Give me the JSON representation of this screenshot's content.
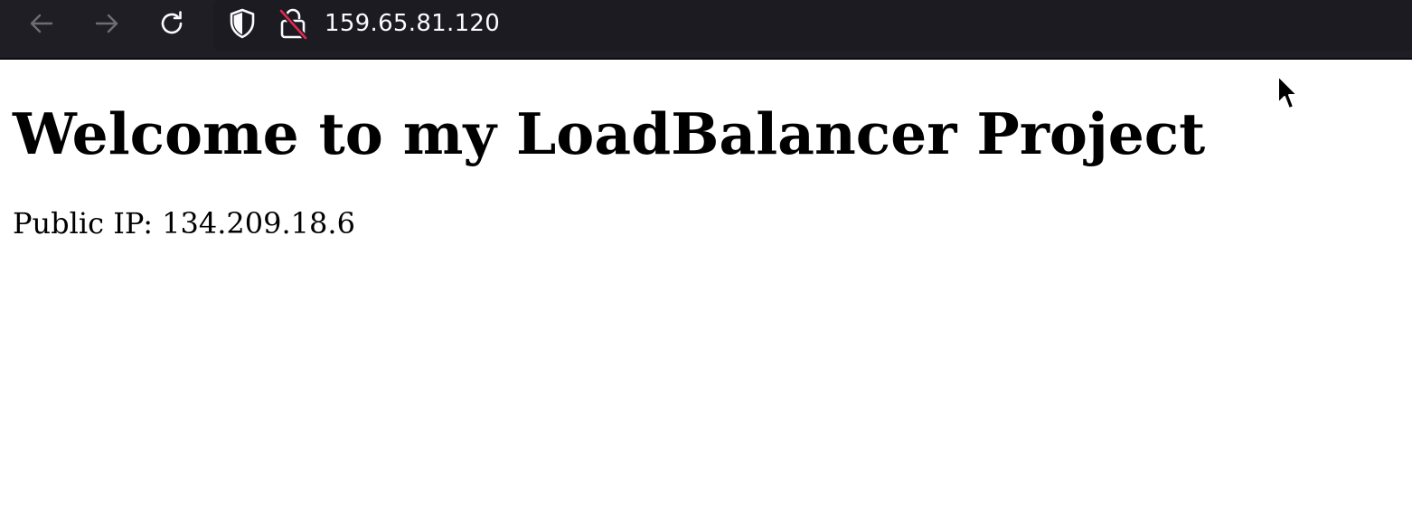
{
  "browser": {
    "url": "159.65.81.120",
    "icons": {
      "back": "arrow-left-icon",
      "forward": "arrow-right-icon",
      "reload": "reload-icon",
      "security": "shield-icon",
      "connection": "insecure-lock-icon"
    }
  },
  "page": {
    "heading": "Welcome to my LoadBalancer Project",
    "ip_text": "Public IP: 134.209.18.6"
  },
  "colors": {
    "toolbar_bg": "#1f1e25",
    "urlbar_bg": "#1c1b22",
    "insecure_strike": "#e22850",
    "disabled_nav": "#6e6d74",
    "active_icon": "#fbfbfe"
  }
}
